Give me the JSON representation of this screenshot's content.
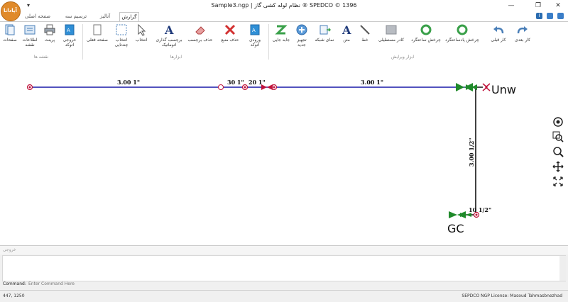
{
  "window": {
    "title": "Sample3.ngp | نظام لوله کشی گاز ® SPEDCO © 1396",
    "logo_text": "آپادانا",
    "qat_glyph": "▾",
    "minimize": "—",
    "restore": "❐",
    "close": "✕"
  },
  "tabs": [
    "گزارش",
    "آنالیز",
    "ترسیم سه بعدی",
    "صفحه اصلی"
  ],
  "ribbon": {
    "groups": {
      "drawing_tools": "ابزار ویرایش",
      "layouts": "ابزارها",
      "map": "نقشه ها"
    },
    "buttons": {
      "next_view": "کار بعدی",
      "prev_view": "کار قبلی",
      "rotate_ccw": "چرخش پادساعتگرد",
      "rotate_cw": "چرخش ساعتگرد",
      "rect_frame": "کادر مستطیلی",
      "line": "خط",
      "text": "متن",
      "grid_view": "نمای شبکه",
      "new_equipment": "تجهیز جدید",
      "move": "جابه جایی",
      "auto_input": "ورودی اتوکد",
      "delete_source": "حذف منبع",
      "delete_label": "حذف برچسب",
      "auto_label": "برچسب گذاری اتوماتیک",
      "select": "انتخاب",
      "multi_select": "انتخاب چندتایی",
      "current_page": "صفحه فعلی",
      "autocad_export": "خروجی اتوکد",
      "print": "پرینت",
      "map_info": "اطلاعات نقشه",
      "pages": "صفحات"
    }
  },
  "drawing": {
    "pipe_labels": [
      {
        "text": "3.00 1\""
      },
      {
        "text": "30 1\""
      },
      {
        "text": "20 1\""
      },
      {
        "text": "3.00 1\""
      },
      {
        "text": "3.00 1/2\""
      },
      {
        "text": "10 1/2\""
      }
    ],
    "node_labels": {
      "unw": "Unw",
      "gc": "GC"
    }
  },
  "command_panel": {
    "title": "خروجی",
    "prompt": "Command:",
    "placeholder": "Enter Command Here"
  },
  "status": {
    "coords": "447, 1250",
    "license": "SEPDCO NGP License:  Masoud Tahmasbnezhad"
  },
  "colors": {
    "pipe": "#1a1aa8",
    "pipe_vertical": "#111111",
    "node": "#c0143c",
    "valve_green": "#1f8a2a",
    "accent": "#2b6cb0"
  }
}
